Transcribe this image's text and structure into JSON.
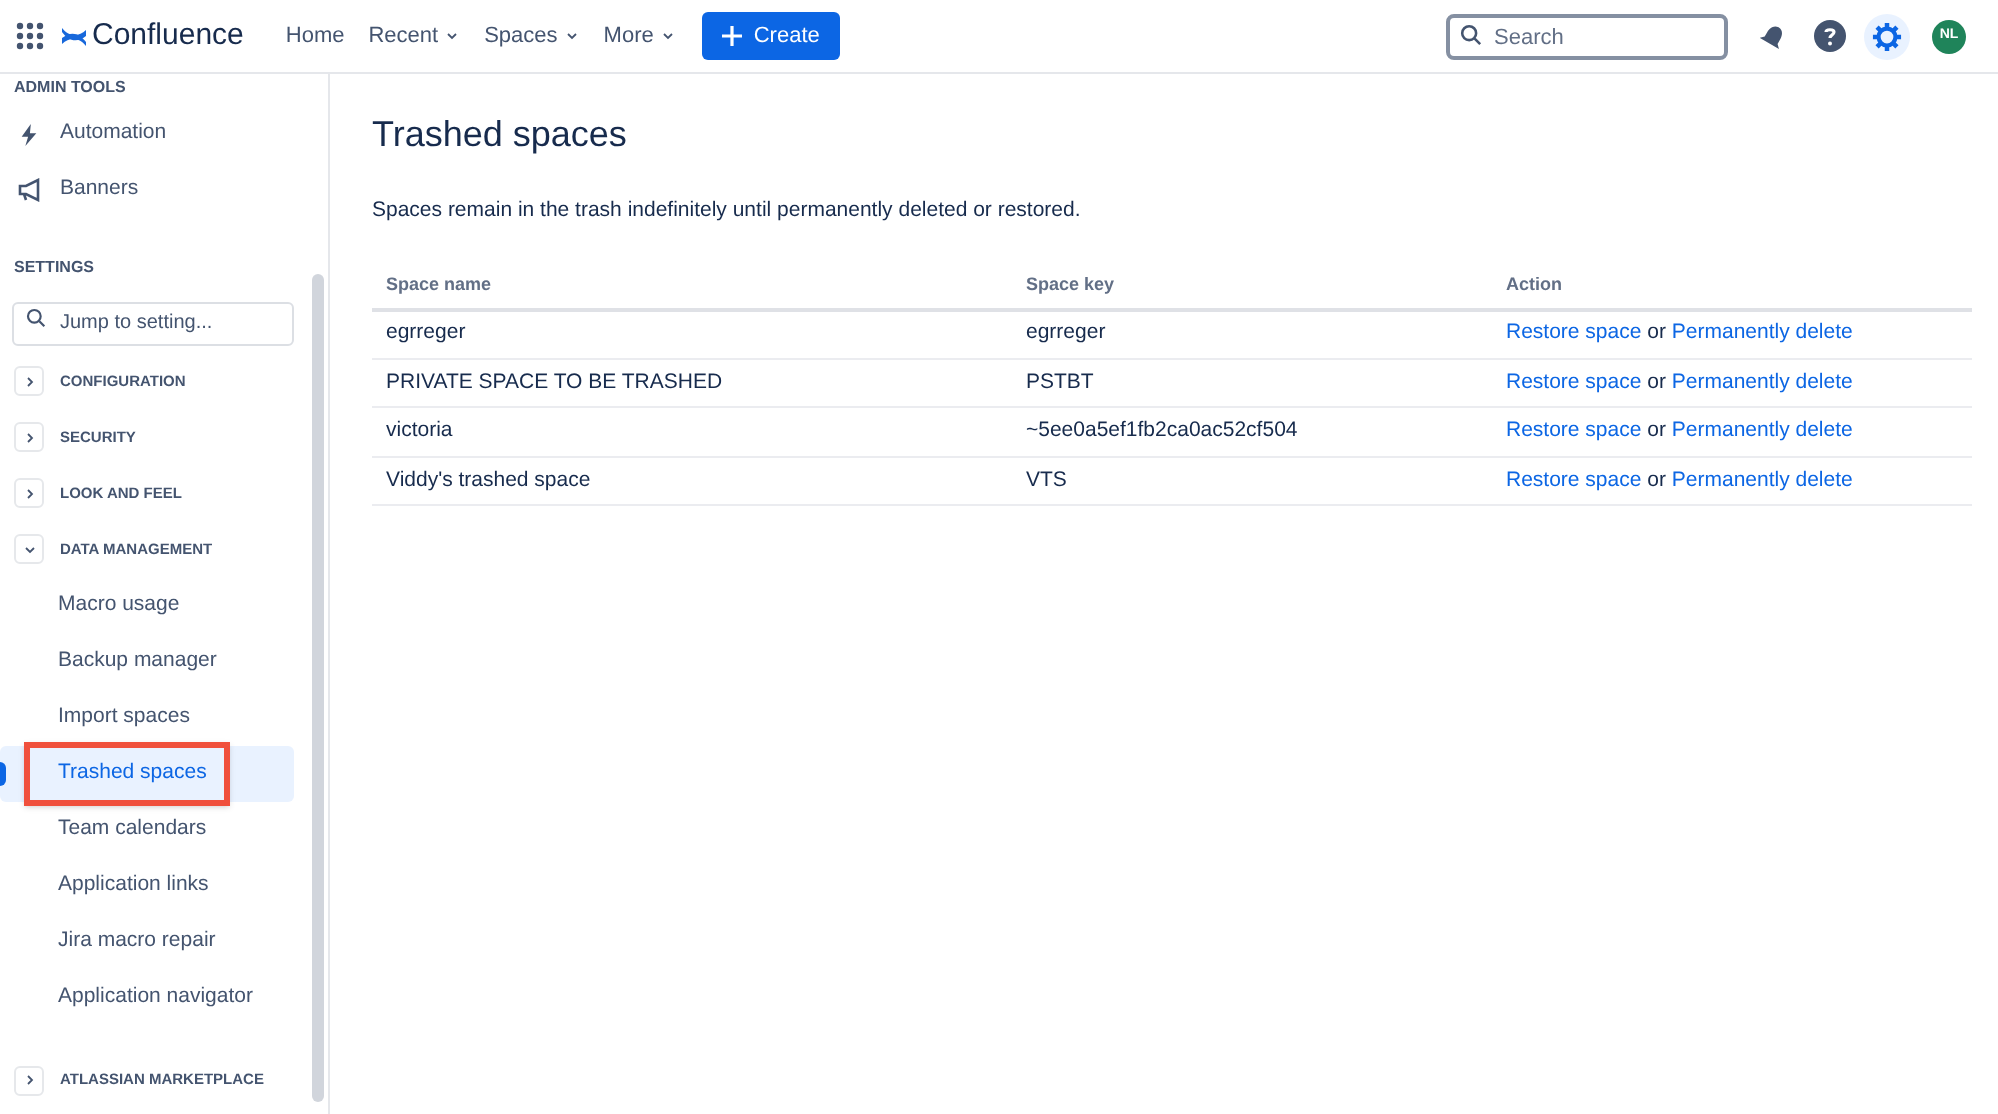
{
  "topnav": {
    "product": "Confluence",
    "links": [
      {
        "label": "Home",
        "dropdown": false
      },
      {
        "label": "Recent",
        "dropdown": true
      },
      {
        "label": "Spaces",
        "dropdown": true
      },
      {
        "label": "More",
        "dropdown": true
      }
    ],
    "create": "Create",
    "search": {
      "placeholder": "Search"
    },
    "avatar": "NL"
  },
  "sidebar": {
    "admin_heading": "ADMIN TOOLS",
    "admin_items": [
      {
        "label": "Automation",
        "kind": "bolt"
      },
      {
        "label": "Banners",
        "kind": "megaphone"
      }
    ],
    "settings_heading": "SETTINGS",
    "filter": {
      "placeholder": "Jump to setting..."
    },
    "groups": [
      {
        "label": "CONFIGURATION",
        "expanded": false
      },
      {
        "label": "SECURITY",
        "expanded": false
      },
      {
        "label": "LOOK AND FEEL",
        "expanded": false
      },
      {
        "label": "DATA MANAGEMENT",
        "expanded": true,
        "children": [
          {
            "label": "Macro usage",
            "selected": false,
            "annotated": false
          },
          {
            "label": "Backup manager",
            "selected": false,
            "annotated": false
          },
          {
            "label": "Import spaces",
            "selected": false,
            "annotated": false
          },
          {
            "label": "Trashed spaces",
            "selected": true,
            "annotated": true
          },
          {
            "label": "Team calendars",
            "selected": false,
            "annotated": false
          },
          {
            "label": "Application links",
            "selected": false,
            "annotated": false
          },
          {
            "label": "Jira macro repair",
            "selected": false,
            "annotated": false
          },
          {
            "label": "Application navigator",
            "selected": false,
            "annotated": false
          }
        ]
      },
      {
        "label": "ATLASSIAN MARKETPLACE",
        "expanded": false
      }
    ]
  },
  "page": {
    "title": "Trashed spaces",
    "description": "Spaces remain in the trash indefinitely until permanently deleted or restored.",
    "table": {
      "columns": [
        "Space name",
        "Space key",
        "Action"
      ],
      "rows": [
        {
          "name": "egrreger",
          "key": "egrreger",
          "restore": "Restore space",
          "or": "or",
          "delete": "Permanently delete"
        },
        {
          "name": "PRIVATE SPACE TO BE TRASHED",
          "key": "PSTBT",
          "restore": "Restore space",
          "or": "or",
          "delete": "Permanently delete"
        },
        {
          "name": "victoria",
          "key": "~5ee0a5ef1fb2ca0ac52cf504",
          "restore": "Restore space",
          "or": "or",
          "delete": "Permanently delete"
        },
        {
          "name": "Viddy's trashed space",
          "key": "VTS",
          "restore": "Restore space",
          "or": "or",
          "delete": "Permanently delete"
        }
      ]
    }
  }
}
